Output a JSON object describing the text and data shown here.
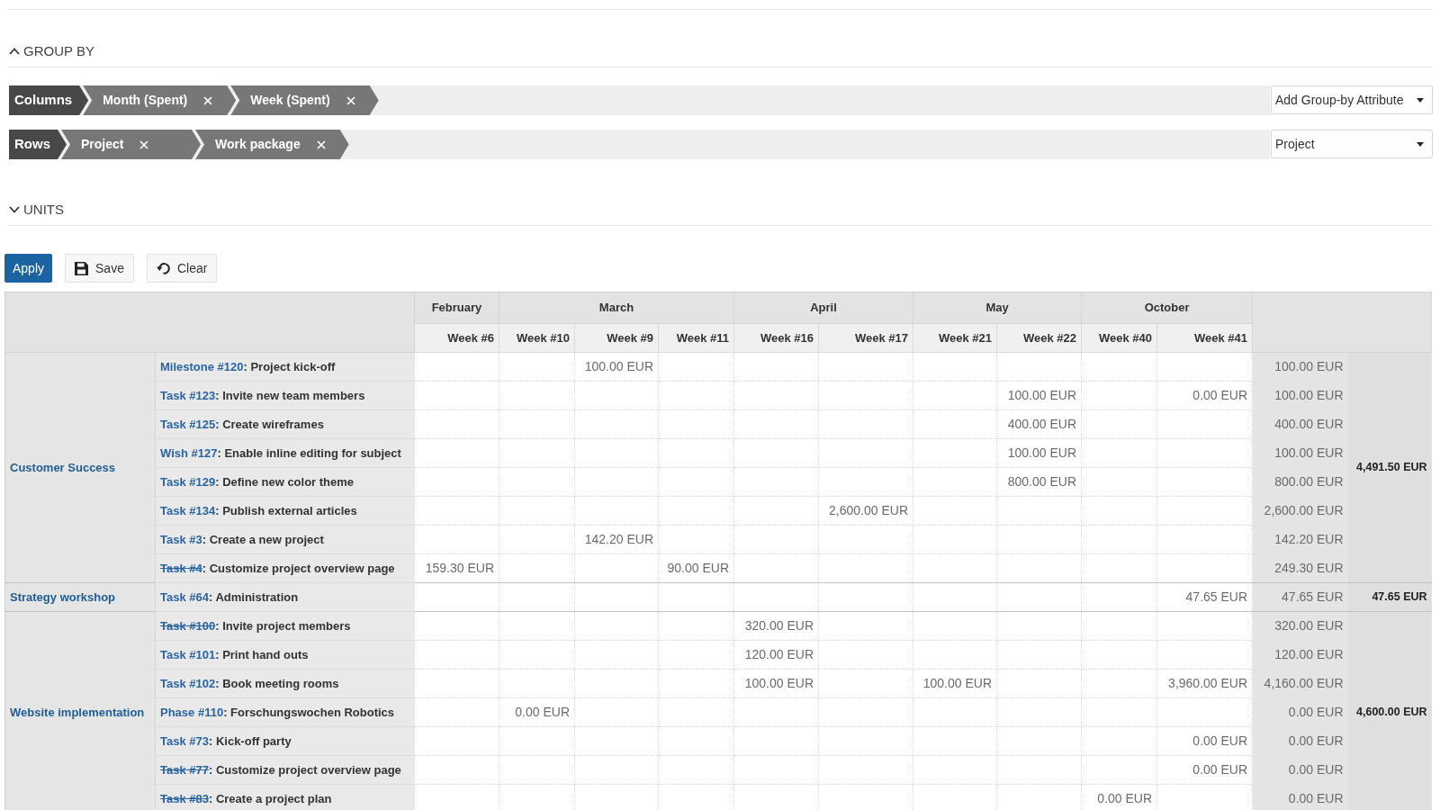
{
  "group_by": {
    "title": "GROUP BY",
    "expanded": true,
    "rows": [
      {
        "label": "Columns",
        "items": [
          "Month (Spent)",
          "Week (Spent)"
        ],
        "select": "Add Group-by Attribute"
      },
      {
        "label": "Rows",
        "items": [
          "Project",
          "Work package"
        ],
        "select": "Project"
      }
    ]
  },
  "units": {
    "title": "UNITS",
    "expanded": false
  },
  "buttons": [
    {
      "label": "Apply",
      "kind": "primary"
    },
    {
      "label": "Save",
      "kind": "save"
    },
    {
      "label": "Clear",
      "kind": "clear"
    }
  ],
  "report": {
    "months": [
      {
        "label": "February",
        "weeks": [
          "Week #6"
        ]
      },
      {
        "label": "March",
        "weeks": [
          "Week #10",
          "Week #9",
          "Week #11"
        ]
      },
      {
        "label": "April",
        "weeks": [
          "Week #16",
          "Week #17"
        ]
      },
      {
        "label": "May",
        "weeks": [
          "Week #21",
          "Week #22"
        ]
      },
      {
        "label": "October",
        "weeks": [
          "Week #40",
          "Week #41"
        ]
      }
    ],
    "projects": [
      {
        "name": "Customer Success",
        "total": "4,491.50 EUR",
        "work_packages": [
          {
            "link": "Milestone #120",
            "subject": ": Project kick-off",
            "closed": false,
            "cells": [
              null,
              null,
              "100.00 EUR",
              null,
              null,
              null,
              null,
              null,
              null,
              null
            ],
            "total": "100.00 EUR"
          },
          {
            "link": "Task #123",
            "subject": ": Invite new team members",
            "closed": false,
            "cells": [
              null,
              null,
              null,
              null,
              null,
              null,
              null,
              "100.00 EUR",
              null,
              "0.00 EUR"
            ],
            "total": "100.00 EUR"
          },
          {
            "link": "Task #125",
            "subject": ": Create wireframes",
            "closed": false,
            "cells": [
              null,
              null,
              null,
              null,
              null,
              null,
              null,
              "400.00 EUR",
              null,
              null
            ],
            "total": "400.00 EUR"
          },
          {
            "link": "Wish #127",
            "subject": ": Enable inline editing for subject",
            "closed": false,
            "cells": [
              null,
              null,
              null,
              null,
              null,
              null,
              null,
              "100.00 EUR",
              null,
              null
            ],
            "total": "100.00 EUR"
          },
          {
            "link": "Task #129",
            "subject": ": Define new color theme",
            "closed": false,
            "cells": [
              null,
              null,
              null,
              null,
              null,
              null,
              null,
              "800.00 EUR",
              null,
              null
            ],
            "total": "800.00 EUR"
          },
          {
            "link": "Task #134",
            "subject": ": Publish external articles",
            "closed": false,
            "cells": [
              null,
              null,
              null,
              null,
              null,
              "2,600.00 EUR",
              null,
              null,
              null,
              null
            ],
            "total": "2,600.00 EUR"
          },
          {
            "link": "Task #3",
            "subject": ": Create a new project",
            "closed": false,
            "cells": [
              null,
              null,
              "142.20 EUR",
              null,
              null,
              null,
              null,
              null,
              null,
              null
            ],
            "total": "142.20 EUR"
          },
          {
            "link": "Task #4",
            "subject": ": Customize project overview page",
            "closed": true,
            "cells": [
              "159.30 EUR",
              null,
              null,
              "90.00 EUR",
              null,
              null,
              null,
              null,
              null,
              null
            ],
            "total": "249.30 EUR"
          }
        ]
      },
      {
        "name": "Strategy workshop",
        "total": "47.65 EUR",
        "work_packages": [
          {
            "link": "Task #64",
            "subject": ": Administration",
            "closed": false,
            "cells": [
              null,
              null,
              null,
              null,
              null,
              null,
              null,
              null,
              null,
              "47.65 EUR"
            ],
            "total": "47.65 EUR"
          }
        ]
      },
      {
        "name": "Website implementation",
        "total": "4,600.00 EUR",
        "work_packages": [
          {
            "link": "Task #100",
            "subject": ": Invite project members",
            "closed": true,
            "cells": [
              null,
              null,
              null,
              null,
              "320.00 EUR",
              null,
              null,
              null,
              null,
              null
            ],
            "total": "320.00 EUR"
          },
          {
            "link": "Task #101",
            "subject": ": Print hand outs",
            "closed": false,
            "cells": [
              null,
              null,
              null,
              null,
              "120.00 EUR",
              null,
              null,
              null,
              null,
              null
            ],
            "total": "120.00 EUR"
          },
          {
            "link": "Task #102",
            "subject": ": Book meeting rooms",
            "closed": false,
            "cells": [
              null,
              null,
              null,
              null,
              "100.00 EUR",
              null,
              "100.00 EUR",
              null,
              null,
              "3,960.00 EUR"
            ],
            "total": "4,160.00 EUR"
          },
          {
            "link": "Phase #110",
            "subject": ": Forschungswochen Robotics",
            "closed": false,
            "cells": [
              null,
              "0.00 EUR",
              null,
              null,
              null,
              null,
              null,
              null,
              null,
              null
            ],
            "total": "0.00 EUR"
          },
          {
            "link": "Task #73",
            "subject": ": Kick-off party",
            "closed": false,
            "cells": [
              null,
              null,
              null,
              null,
              null,
              null,
              null,
              null,
              null,
              "0.00 EUR"
            ],
            "total": "0.00 EUR"
          },
          {
            "link": "Task #77",
            "subject": ": Customize project overview page",
            "closed": true,
            "cells": [
              null,
              null,
              null,
              null,
              null,
              null,
              null,
              null,
              null,
              "0.00 EUR"
            ],
            "total": "0.00 EUR"
          },
          {
            "link": "Task #83",
            "subject": ": Create a project plan",
            "closed": true,
            "cells": [
              null,
              null,
              null,
              null,
              null,
              null,
              null,
              null,
              "0.00 EUR",
              null
            ],
            "total": "0.00 EUR"
          }
        ]
      }
    ]
  }
}
